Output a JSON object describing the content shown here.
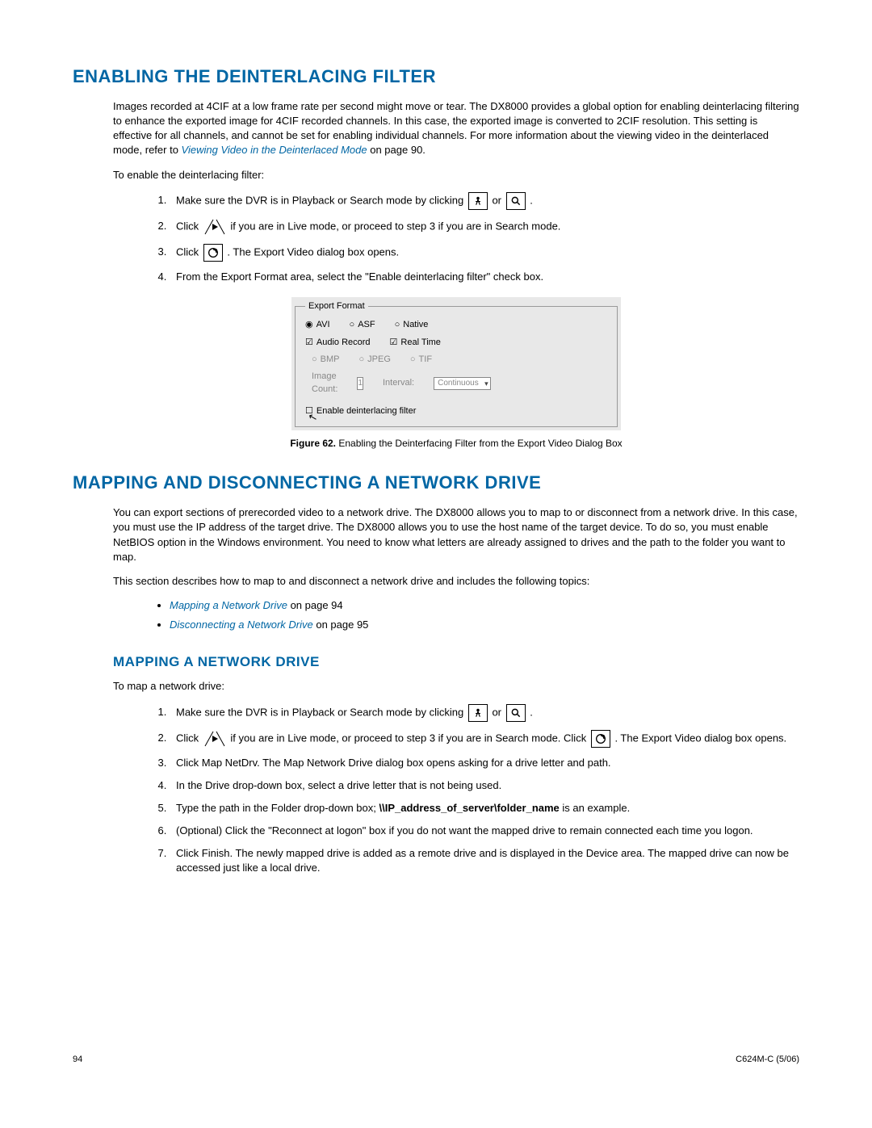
{
  "h1_deinterlace": "ENABLING THE DEINTERLACING FILTER",
  "p_deinterlace_1a": "Images recorded at 4CIF at a low frame rate per second might move or tear. The DX8000 provides a global option for enabling deinterlacing filtering to enhance the exported image for 4CIF recorded channels. In this case, the exported image is converted to 2CIF resolution. This setting is effective for all channels, and cannot be set for enabling individual channels. For more information about the viewing video in the deinterlaced mode, refer to ",
  "link_viewing": "Viewing Video in the Deinterlaced Mode",
  "p_deinterlace_1b": " on page 90.",
  "p_enable_lead": "To enable the deinterlacing filter:",
  "step_playback_a": "Make sure the DVR is in Playback or Search mode by clicking ",
  "or_text": " or ",
  "step_click_a": "Click ",
  "step_click_b": " if you are in Live mode, or proceed to step 3 if you are in Search mode.",
  "step_click_c": ". The Export Video dialog box opens.",
  "step4": "From the Export Format area, select the \"Enable deinterlacing filter\" check box.",
  "export": {
    "legend": "Export Format",
    "avi": "AVI",
    "asf": "ASF",
    "native": "Native",
    "bmp": "BMP",
    "jpeg": "JPEG",
    "tif": "TIF",
    "audio": "Audio Record",
    "realtime": "Real Time",
    "imgcount": "Image Count:",
    "imgcount_val": "1",
    "interval": "Interval:",
    "interval_val": "Continuous",
    "enable": "Enable deinterlacing filter"
  },
  "fig62_label": "Figure 62.",
  "fig62_text": "  Enabling the Deinterfacing Filter from the Export Video Dialog Box",
  "h1_mapping": "MAPPING AND DISCONNECTING A NETWORK DRIVE",
  "p_map_intro": "You can export sections of prerecorded video to a network drive. The DX8000 allows you to map to or disconnect from a network drive. In this case, you must use the IP address of the target drive. The DX8000 allows you to use the host name of the target device. To do so, you must enable NetBIOS option in the Windows environment. You need to know what letters are already assigned to drives and the path to the folder you want to map.",
  "p_map_topics": "This section describes how to map to and disconnect a network drive and includes the following topics:",
  "link_map": "Mapping a Network Drive",
  "link_map_suffix": " on page 94",
  "link_disc": "Disconnecting a Network Drive",
  "link_disc_suffix": " on page 95",
  "h2_map": "MAPPING A NETWORK DRIVE",
  "p_map_lead": "To map a network drive:",
  "map_step2_c": " if you are in Live mode, or proceed to step 3 if you are in Search mode. Click ",
  "map_step3": "Click Map NetDrv. The Map Network Drive dialog box opens asking for a drive letter and path.",
  "map_step4": "In the Drive drop-down box, select a drive letter that is not being used.",
  "map_step5_a": "Type the path in the Folder drop-down box; ",
  "map_step5_path": "\\\\IP_address_of_server\\folder_name",
  "map_step5_b": " is an example.",
  "map_step6": "(Optional) Click the \"Reconnect at logon\" box if you do not want the mapped drive to remain connected each time you logon.",
  "map_step7": "Click Finish. The newly mapped drive is added as a remote drive and is displayed in the Device area. The mapped drive can now be accessed just like a local drive.",
  "footer_page": "94",
  "footer_doc": "C624M-C (5/06)"
}
